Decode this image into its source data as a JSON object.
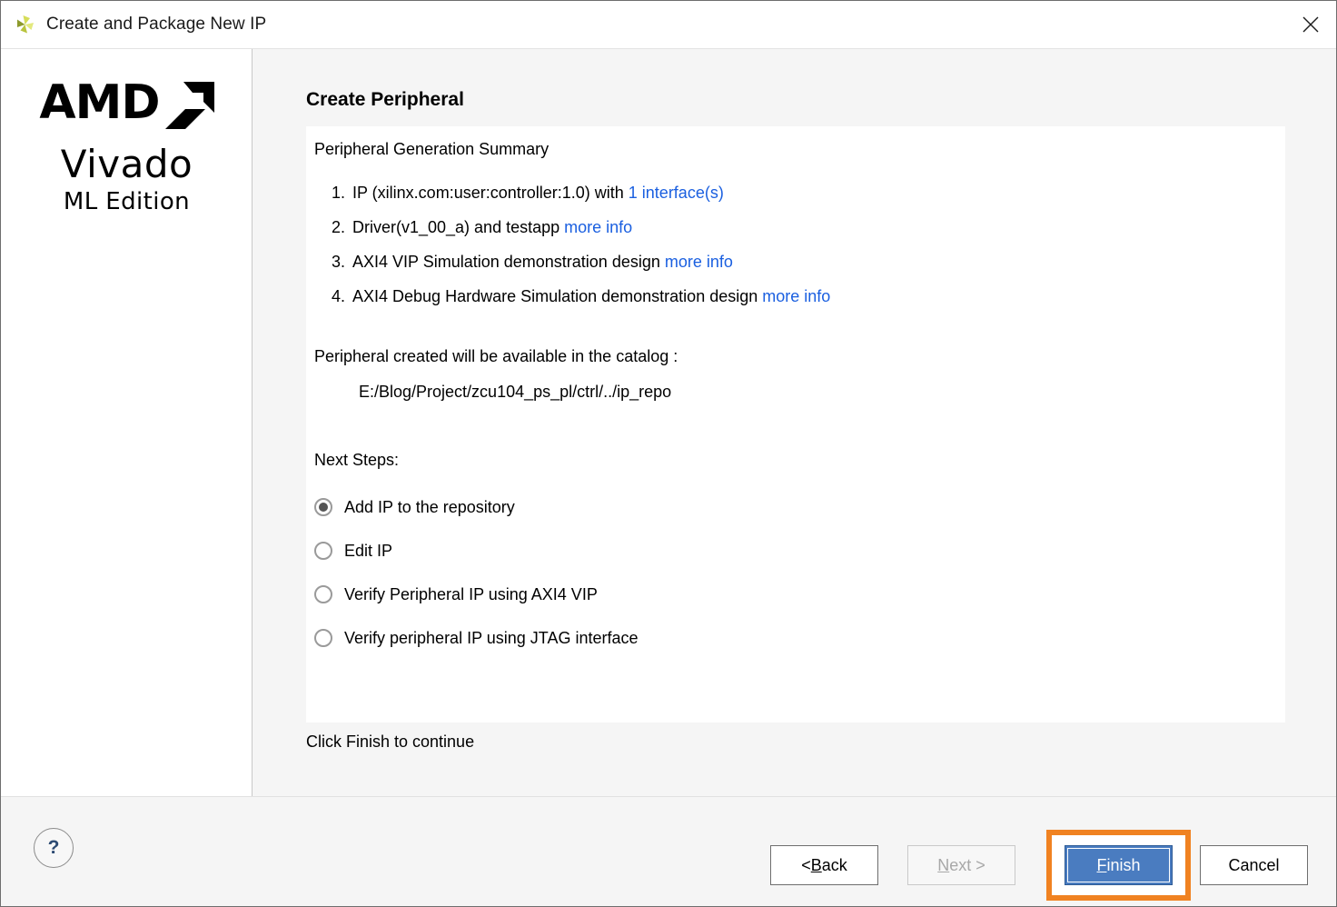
{
  "window": {
    "title": "Create and Package New IP",
    "icon": "vivado-pinwheel-icon",
    "close_icon": "close-icon"
  },
  "sidebar": {
    "brand_amd": "AMD",
    "brand_mark": "amd-arrow-icon",
    "brand_product": "Vivado",
    "brand_edition": "ML Edition"
  },
  "main": {
    "page_title": "Create Peripheral",
    "summary_heading": "Peripheral Generation Summary",
    "steps": [
      {
        "num": "1.",
        "pre": "IP (xilinx.com:user:controller:1.0) with ",
        "link": "1 interface(s)",
        "post": ""
      },
      {
        "num": "2.",
        "pre": "Driver(v1_00_a) and testapp ",
        "link": "more info",
        "post": ""
      },
      {
        "num": "3.",
        "pre": "AXI4 VIP Simulation demonstration design ",
        "link": "more info",
        "post": ""
      },
      {
        "num": "4.",
        "pre": "AXI4 Debug Hardware Simulation demonstration design ",
        "link": "more info",
        "post": ""
      }
    ],
    "catalog_label": "Peripheral created will be available in the catalog :",
    "catalog_path": "E:/Blog/Project/zcu104_ps_pl/ctrl/../ip_repo",
    "next_steps_label": "Next Steps:",
    "next_steps_options": [
      {
        "label": "Add IP to the repository",
        "selected": true
      },
      {
        "label": "Edit IP",
        "selected": false
      },
      {
        "label": "Verify Peripheral IP using AXI4 VIP",
        "selected": false
      },
      {
        "label": "Verify peripheral IP using JTAG interface",
        "selected": false
      }
    ],
    "hint": "Click Finish to continue"
  },
  "footer": {
    "help_label": "?",
    "back": {
      "pre": "< ",
      "mnemonic": "B",
      "post": "ack"
    },
    "next": {
      "pre": "",
      "mnemonic": "N",
      "post": "ext >",
      "disabled": true
    },
    "finish": {
      "pre": "",
      "mnemonic": "F",
      "post": "inish",
      "primary": true
    },
    "cancel": {
      "label": "Cancel"
    }
  },
  "annotation": {
    "highlight_color": "#f08221",
    "target": "finish-button"
  },
  "colors": {
    "link": "#1a5fe0",
    "primary_button": "#4a7cc0",
    "panel_bg": "#f5f5f5",
    "white": "#ffffff",
    "help_glyph": "#2c4a72"
  }
}
